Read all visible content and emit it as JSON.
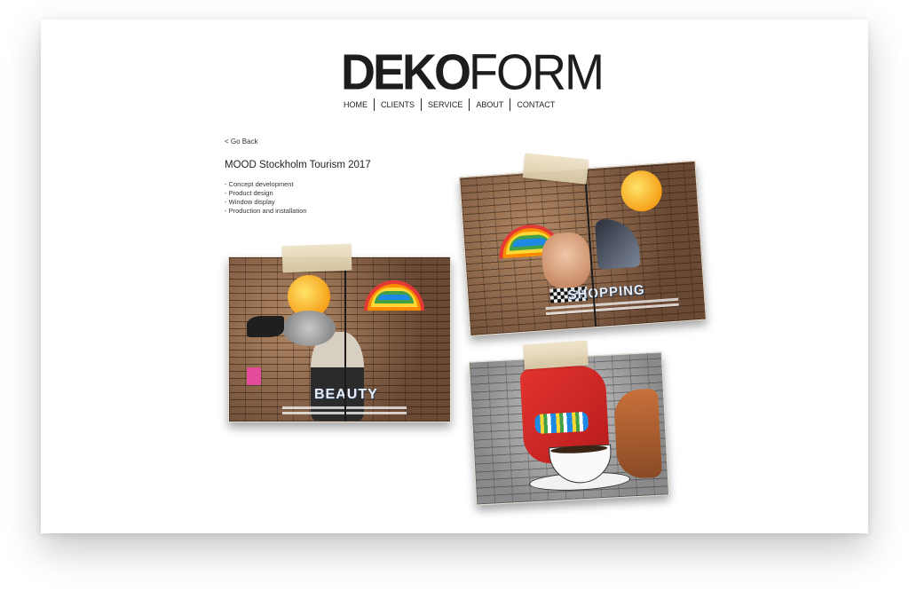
{
  "header": {
    "logo_bold": "DEKO",
    "logo_light": "FORM"
  },
  "nav": {
    "items": [
      "HOME",
      "CLIENTS",
      "SERVICE",
      "ABOUT",
      "CONTACT"
    ]
  },
  "project": {
    "go_back": "< Go Back",
    "title": "MOOD Stockholm Tourism 2017",
    "bullets": [
      "- Concept development",
      "- Product design",
      "- Window display",
      "- Production and installation"
    ]
  },
  "photos": [
    {
      "word": "BEAUTY",
      "theme": "brick-warm"
    },
    {
      "word": "SHOPPING",
      "theme": "brick-warm"
    },
    {
      "word": "",
      "theme": "brick-grey"
    }
  ],
  "colors": {
    "text": "#222222",
    "background": "#ffffff",
    "logo": "#1d1d1d"
  }
}
